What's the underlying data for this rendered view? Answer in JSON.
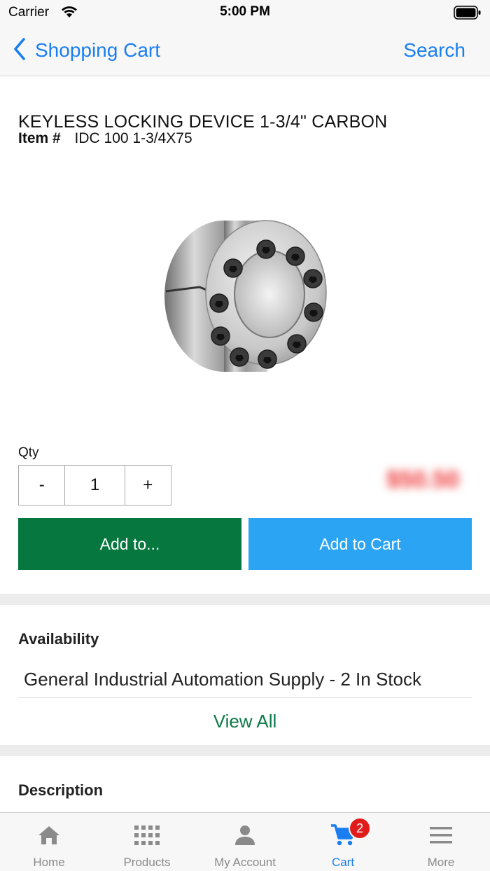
{
  "status_bar": {
    "carrier": "Carrier",
    "time": "5:00 PM",
    "icons": [
      "wifi-icon",
      "battery-icon"
    ]
  },
  "nav": {
    "back_label": "Shopping Cart",
    "search_label": "Search",
    "accent_color": "#1a7ef0"
  },
  "product": {
    "title": "KEYLESS LOCKING DEVICE 1-3/4\" CARBON",
    "item_label": "Item #",
    "item_number": "IDC 100 1-3/4X75",
    "image_icon": "keyless-locking-device-image"
  },
  "purchase": {
    "qty_label": "Qty",
    "decrement_label": "-",
    "quantity": "1",
    "increment_label": "+",
    "price": "$50.50",
    "add_to_label": "Add to...",
    "add_to_cart_label": "Add to Cart",
    "add_to_color": "#06773f",
    "add_to_cart_color": "#2ba4f4"
  },
  "availability": {
    "title": "Availability",
    "row": "General Industrial Automation Supply - 2 In Stock",
    "view_all_label": "View All"
  },
  "description": {
    "title": "Description"
  },
  "tab_bar": {
    "tabs": [
      {
        "label": "Home",
        "icon": "home-icon"
      },
      {
        "label": "Products",
        "icon": "grid-icon"
      },
      {
        "label": "My Account",
        "icon": "person-icon"
      },
      {
        "label": "Cart",
        "icon": "cart-icon",
        "badge": "2",
        "active": true
      },
      {
        "label": "More",
        "icon": "menu-icon"
      }
    ]
  }
}
